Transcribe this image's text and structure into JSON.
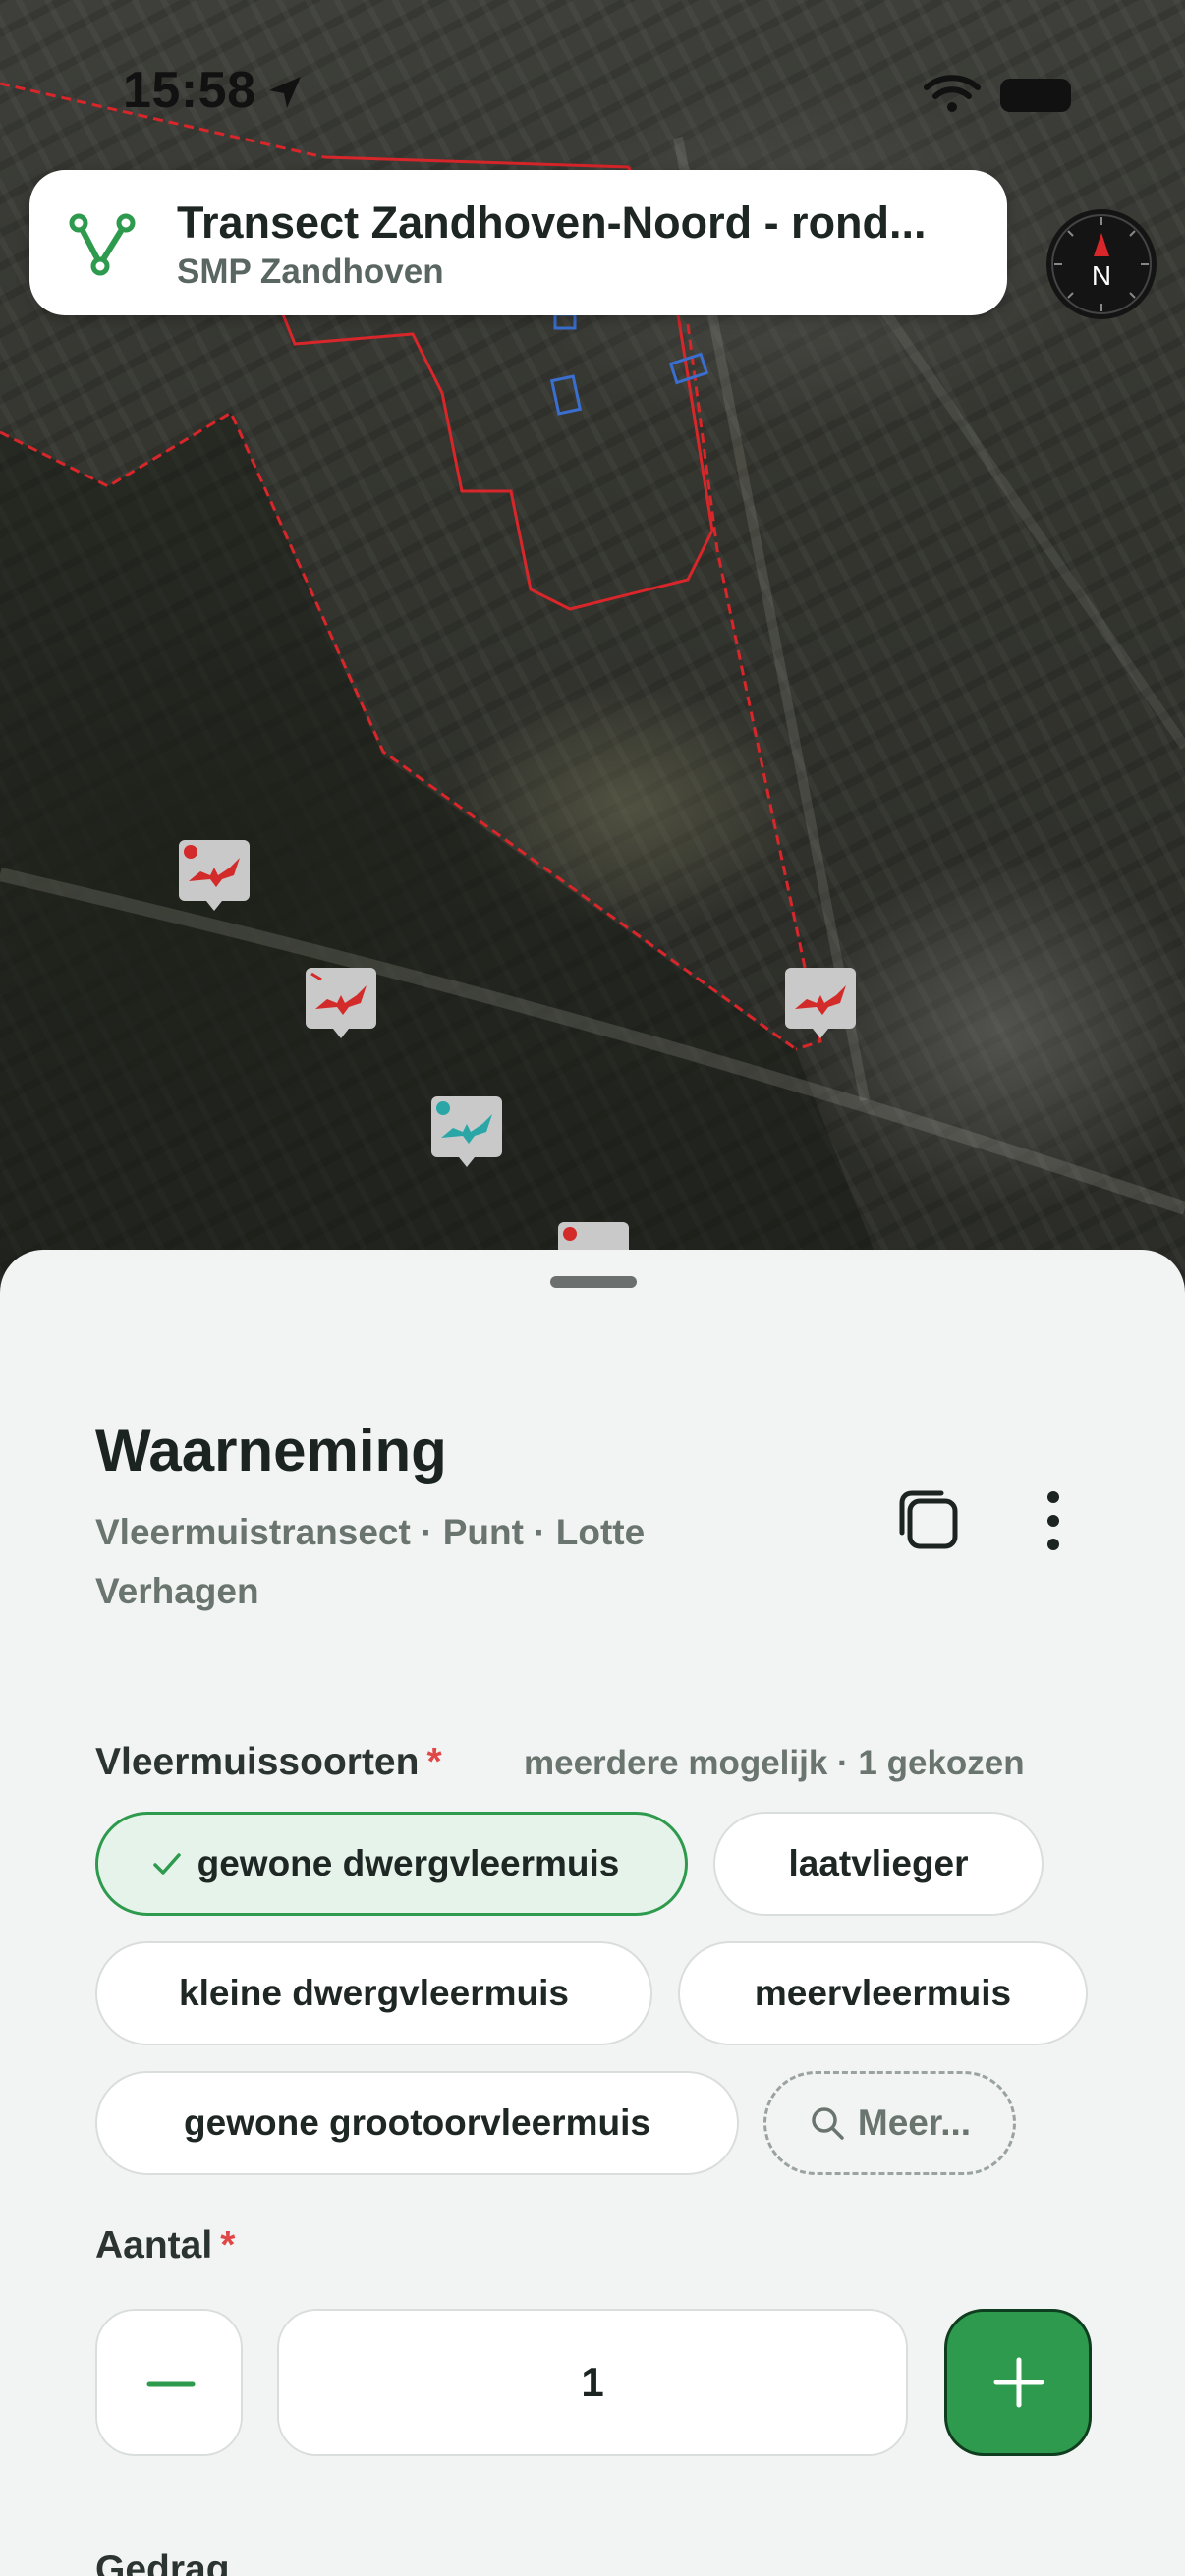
{
  "status_bar": {
    "time": "15:58"
  },
  "header": {
    "title": "Transect Zandhoven-Noord - rond...",
    "subtitle": "SMP Zandhoven"
  },
  "compass": {
    "label": "N"
  },
  "map": {
    "markers": [
      {
        "kind": "bat",
        "color": "#d32a2a"
      },
      {
        "kind": "bat",
        "color": "#d32a2a"
      },
      {
        "kind": "bat",
        "color": "#d32a2a"
      },
      {
        "kind": "bat",
        "color": "#2aa6a6"
      },
      {
        "kind": "bat",
        "color": "#d32a2a"
      }
    ],
    "boundary_color": "#d8262a",
    "feature_color": "#3a6fd0"
  },
  "sheet": {
    "title": "Waarneming",
    "subtitle": "Vleermuistransect · Punt · Lotte Verhagen",
    "species": {
      "label": "Vleermuissoorten",
      "required_mark": "*",
      "hint": "meerdere mogelijk · 1 gekozen",
      "options": [
        {
          "label": "gewone dwergvleermuis",
          "selected": true
        },
        {
          "label": "laatvlieger",
          "selected": false
        },
        {
          "label": "kleine dwergvleermuis",
          "selected": false
        },
        {
          "label": "meervleermuis",
          "selected": false
        },
        {
          "label": "gewone grootoorvleermuis",
          "selected": false
        }
      ],
      "more_label": "Meer..."
    },
    "count": {
      "label": "Aantal",
      "required_mark": "*",
      "value": "1"
    },
    "behavior": {
      "label": "Gedrag"
    }
  },
  "colors": {
    "accent": "#2e9a4d",
    "required": "#e04848"
  }
}
